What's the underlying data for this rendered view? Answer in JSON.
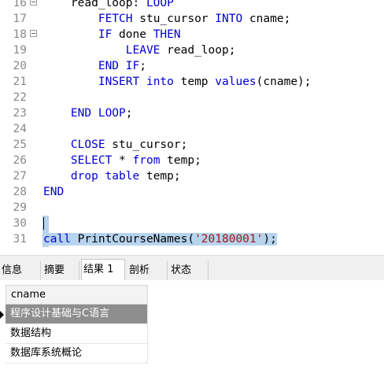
{
  "editor": {
    "lines": [
      {
        "n": "16",
        "fold": true,
        "segs": [
          {
            "t": "    read_loop: "
          },
          {
            "t": "LOOP",
            "k": 1
          }
        ]
      },
      {
        "n": "17",
        "fold": false,
        "segs": [
          {
            "t": "        "
          },
          {
            "t": "FETCH",
            "k": 1
          },
          {
            "t": " stu_cursor "
          },
          {
            "t": "INTO",
            "k": 1
          },
          {
            "t": " cname;"
          }
        ]
      },
      {
        "n": "18",
        "fold": true,
        "segs": [
          {
            "t": "        "
          },
          {
            "t": "IF",
            "k": 1
          },
          {
            "t": " done "
          },
          {
            "t": "THEN",
            "k": 1
          }
        ]
      },
      {
        "n": "19",
        "fold": false,
        "segs": [
          {
            "t": "            "
          },
          {
            "t": "LEAVE",
            "k": 1
          },
          {
            "t": " read_loop;"
          }
        ]
      },
      {
        "n": "20",
        "fold": false,
        "segs": [
          {
            "t": "        "
          },
          {
            "t": "END IF",
            "k": 1
          },
          {
            "t": ";"
          }
        ]
      },
      {
        "n": "21",
        "fold": false,
        "segs": [
          {
            "t": "        "
          },
          {
            "t": "INSERT",
            "k": 1
          },
          {
            "t": " "
          },
          {
            "t": "into",
            "k": 1
          },
          {
            "t": " temp "
          },
          {
            "t": "values",
            "k": 1
          },
          {
            "t": "(cname);"
          }
        ]
      },
      {
        "n": "22",
        "fold": false,
        "segs": []
      },
      {
        "n": "23",
        "fold": false,
        "segs": [
          {
            "t": "    "
          },
          {
            "t": "END LOOP",
            "k": 1
          },
          {
            "t": ";"
          }
        ]
      },
      {
        "n": "24",
        "fold": false,
        "segs": []
      },
      {
        "n": "25",
        "fold": false,
        "segs": [
          {
            "t": "    "
          },
          {
            "t": "CLOSE",
            "k": 1
          },
          {
            "t": " stu_cursor;"
          }
        ]
      },
      {
        "n": "26",
        "fold": false,
        "segs": [
          {
            "t": "    "
          },
          {
            "t": "SELECT",
            "k": 1
          },
          {
            "t": " * "
          },
          {
            "t": "from",
            "k": 1
          },
          {
            "t": " temp;"
          }
        ]
      },
      {
        "n": "27",
        "fold": false,
        "segs": [
          {
            "t": "    "
          },
          {
            "t": "drop",
            "k": 1
          },
          {
            "t": " "
          },
          {
            "t": "table",
            "k": 1
          },
          {
            "t": " temp;"
          }
        ]
      },
      {
        "n": "28",
        "fold": false,
        "segs": [
          {
            "t": "END",
            "k": 1
          }
        ]
      },
      {
        "n": "29",
        "fold": false,
        "segs": []
      },
      {
        "n": "30",
        "fold": false,
        "segs": []
      },
      {
        "n": "31",
        "fold": false,
        "segs": [
          {
            "t": "call",
            "k": 1,
            "sel": 1
          },
          {
            "t": " PrintCourseNames(",
            "sel": 1
          },
          {
            "t": "'20180001'",
            "s": 1,
            "sel": 1
          },
          {
            "t": ");",
            "sel": 1
          }
        ]
      }
    ]
  },
  "tabs": [
    {
      "label": "信息",
      "active": false
    },
    {
      "label": "摘要",
      "active": false
    },
    {
      "label": "结果 1",
      "active": true
    },
    {
      "label": "剖析",
      "active": false
    },
    {
      "label": "状态",
      "active": false
    }
  ],
  "results": {
    "column": "cname",
    "rows": [
      "程序设计基础与C语言",
      "数据结构",
      "数据库系统概论"
    ],
    "selected_row": 0
  }
}
